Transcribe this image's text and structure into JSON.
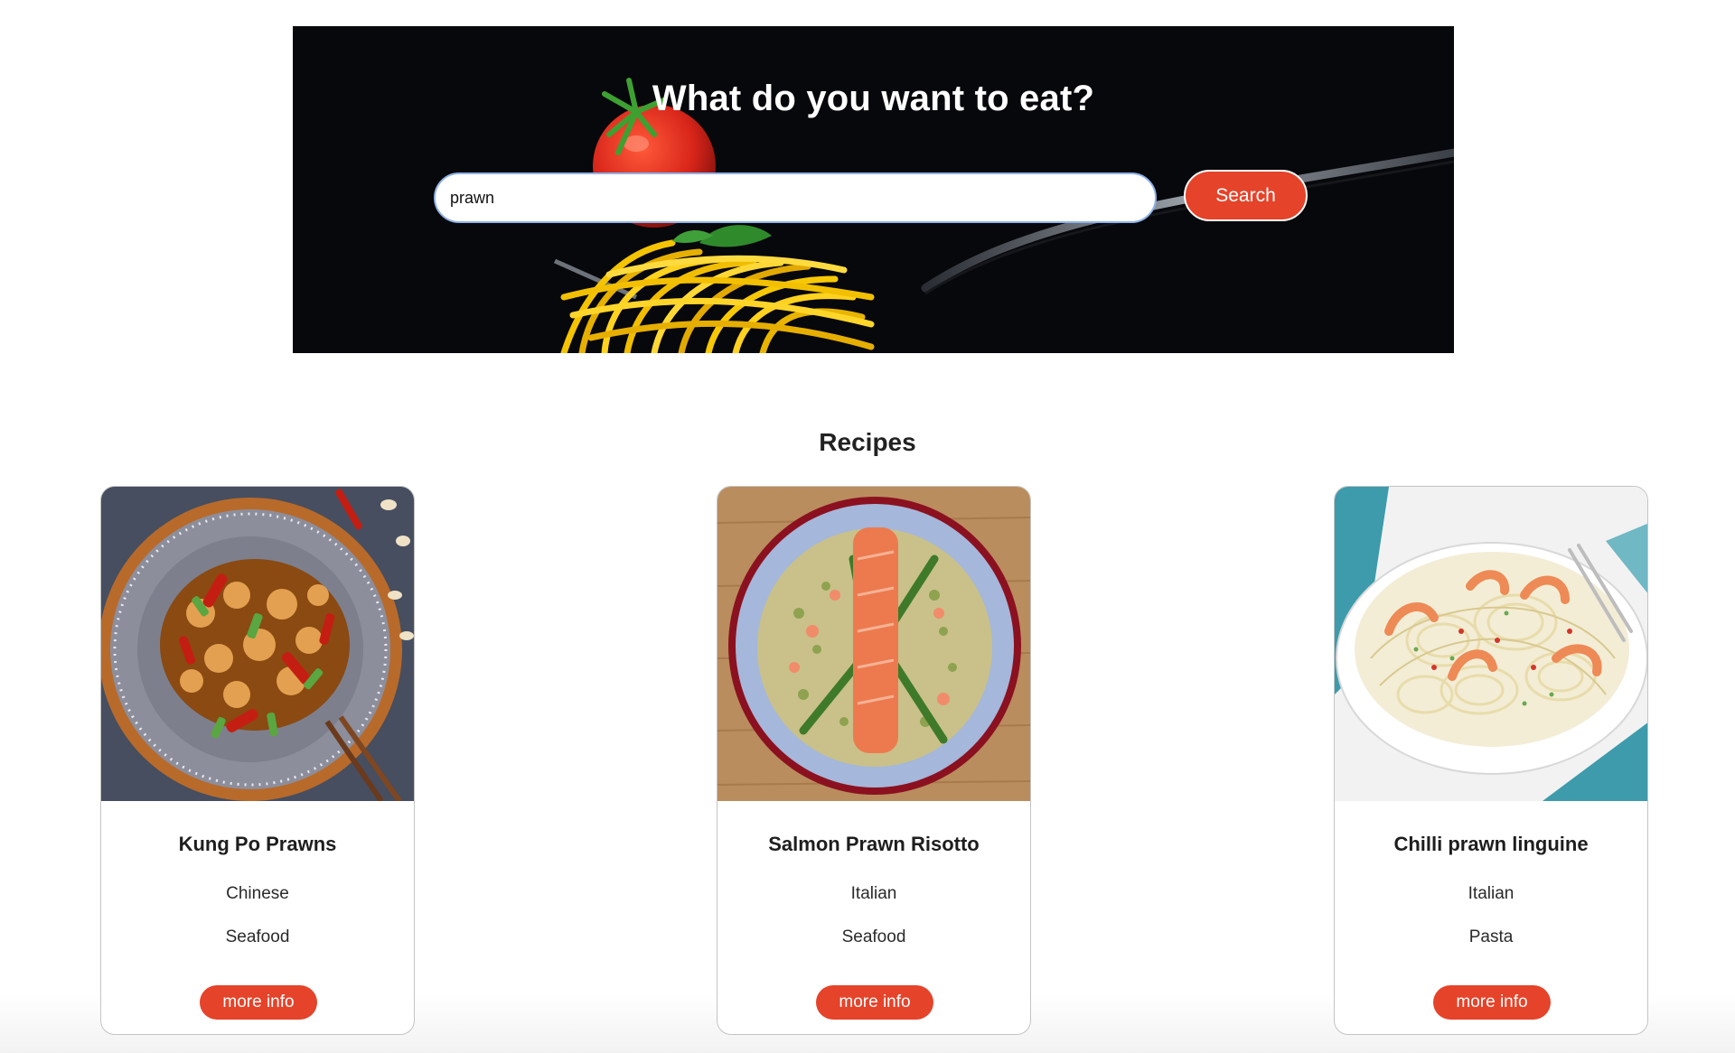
{
  "hero": {
    "title": "What do you want to eat?",
    "search_value": "prawn",
    "search_button_label": "Search",
    "background_color": "#07080b",
    "accent_color": "#e5432a"
  },
  "recipes": {
    "heading": "Recipes",
    "cards": [
      {
        "name": "Kung Po Prawns",
        "area": "Chinese",
        "category": "Seafood",
        "button_label": "more info"
      },
      {
        "name": "Salmon Prawn Risotto",
        "area": "Italian",
        "category": "Seafood",
        "button_label": "more info"
      },
      {
        "name": "Chilli prawn linguine",
        "area": "Italian",
        "category": "Pasta",
        "button_label": "more info"
      }
    ]
  }
}
